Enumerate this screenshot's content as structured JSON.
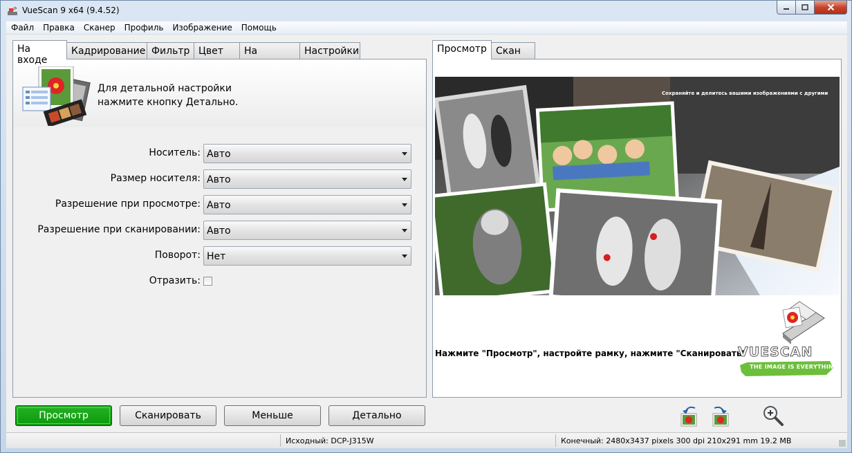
{
  "window": {
    "title": "VueScan 9 x64 (9.4.52)"
  },
  "menu": [
    "Файл",
    "Правка",
    "Сканер",
    "Профиль",
    "Изображение",
    "Помощь"
  ],
  "left_tabs": [
    "На входе",
    "Кадрирование",
    "Фильтр",
    "Цвет",
    "На выходе",
    "Настройки"
  ],
  "right_tabs": [
    "Просмотр",
    "Скан"
  ],
  "hint": {
    "line1": "Для детальной настройки",
    "line2": "нажмите кнопку Детально."
  },
  "form": {
    "media": {
      "label": "Носитель:",
      "value": "Авто"
    },
    "media_size": {
      "label": "Размер носителя:",
      "value": "Авто"
    },
    "preview_res": {
      "label": "Разрешение при просмотре:",
      "value": "Авто"
    },
    "scan_res": {
      "label": "Разрешение при сканировании:",
      "value": "Авто"
    },
    "rotation": {
      "label": "Поворот:",
      "value": "Нет"
    },
    "mirror": {
      "label": "Отразить:",
      "checked": false
    }
  },
  "preview": {
    "collage_caption": "Сохраняйте и делитесь вашими изображениями с другими",
    "message": "Нажмите \"Просмотр\", настройте рамку, нажмите \"Сканировать\"",
    "logo_text": "VUESCAN",
    "logo_tagline": "THE IMAGE IS EVERYTHING"
  },
  "buttons": {
    "preview": "Просмотр",
    "scan": "Сканировать",
    "less": "Меньше",
    "more": "Детально"
  },
  "status": {
    "source": "Исходный: DCP-J315W",
    "output": "Конечный: 2480x3437 pixels 300 dpi 210x291 mm 19.2 MB"
  },
  "colors": {
    "preview_button": "#0c990c",
    "close_button": "#c7432c"
  }
}
